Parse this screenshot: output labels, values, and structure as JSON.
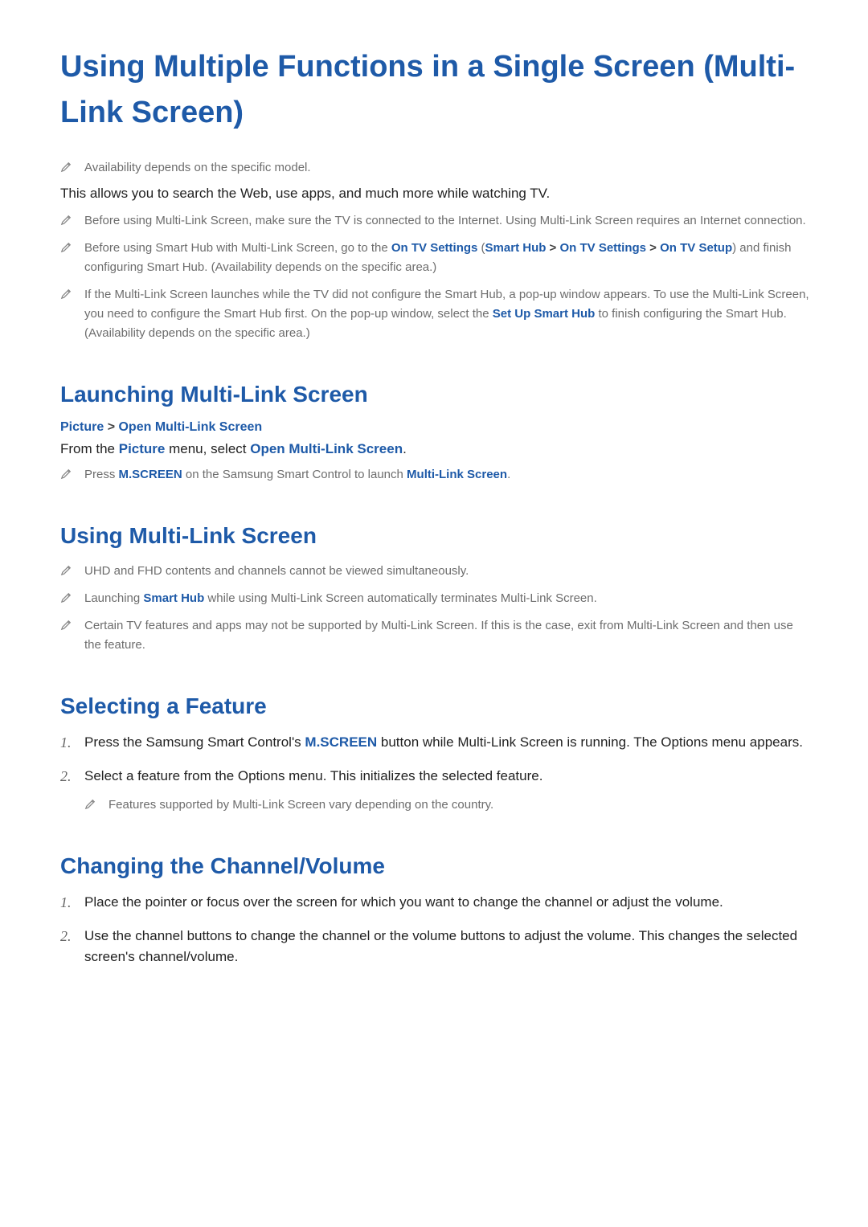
{
  "title": "Using Multiple Functions in a Single Screen (Multi-Link Screen)",
  "top_notes": [
    {
      "segments": [
        {
          "t": "Availability depends on the specific model."
        }
      ]
    }
  ],
  "intro": "This allows you to search the Web, use apps, and much more while watching TV.",
  "intro_notes": [
    {
      "segments": [
        {
          "t": "Before using Multi-Link Screen, make sure the TV is connected to the Internet. Using Multi-Link Screen requires an Internet connection."
        }
      ]
    },
    {
      "segments": [
        {
          "t": "Before using Smart Hub with Multi-Link Screen, go to the "
        },
        {
          "t": "On TV Settings",
          "kw": true
        },
        {
          "t": " ("
        },
        {
          "t": "Smart Hub",
          "kw": true
        },
        {
          "t": " > ",
          "sep": true
        },
        {
          "t": "On TV Settings",
          "kw": true
        },
        {
          "t": " > ",
          "sep": true
        },
        {
          "t": "On TV Setup",
          "kw": true
        },
        {
          "t": ") and finish configuring Smart Hub. (Availability depends on the specific area.)"
        }
      ]
    },
    {
      "segments": [
        {
          "t": "If the Multi-Link Screen launches while the TV did not configure the Smart Hub, a pop-up window appears. To use the Multi-Link Screen, you need to configure the Smart Hub first. On the pop-up window, select the "
        },
        {
          "t": "Set Up Smart Hub",
          "kw": true
        },
        {
          "t": " to finish configuring the Smart Hub. (Availability depends on the specific area.)"
        }
      ]
    }
  ],
  "sections": {
    "launching": {
      "heading": "Launching Multi-Link Screen",
      "breadcrumb": [
        {
          "t": "Picture",
          "kw": true
        },
        {
          "t": "Open Multi-Link Screen",
          "kw": true
        }
      ],
      "text_segments": [
        {
          "t": "From the "
        },
        {
          "t": "Picture",
          "kw": true
        },
        {
          "t": " menu, select "
        },
        {
          "t": "Open Multi-Link Screen",
          "kw": true
        },
        {
          "t": "."
        }
      ],
      "notes": [
        {
          "segments": [
            {
              "t": "Press "
            },
            {
              "t": "M.SCREEN",
              "kw": true
            },
            {
              "t": " on the Samsung Smart Control to launch "
            },
            {
              "t": "Multi-Link Screen",
              "kw": true
            },
            {
              "t": "."
            }
          ]
        }
      ]
    },
    "using": {
      "heading": "Using Multi-Link Screen",
      "notes": [
        {
          "segments": [
            {
              "t": "UHD and FHD contents and channels cannot be viewed simultaneously."
            }
          ]
        },
        {
          "segments": [
            {
              "t": "Launching "
            },
            {
              "t": "Smart Hub",
              "kw": true
            },
            {
              "t": " while using Multi-Link Screen automatically terminates Multi-Link Screen."
            }
          ]
        },
        {
          "segments": [
            {
              "t": "Certain TV features and apps may not be supported by Multi-Link Screen. If this is the case, exit from Multi-Link Screen and then use the feature."
            }
          ]
        }
      ]
    },
    "selecting": {
      "heading": "Selecting a Feature",
      "steps": [
        {
          "segments": [
            {
              "t": "Press the Samsung Smart Control's "
            },
            {
              "t": "M.SCREEN",
              "kw": true
            },
            {
              "t": " button while Multi-Link Screen is running. The Options menu appears."
            }
          ]
        },
        {
          "segments": [
            {
              "t": "Select a feature from the Options menu. This initializes the selected feature."
            }
          ],
          "subnotes": [
            {
              "segments": [
                {
                  "t": "Features supported by Multi-Link Screen vary depending on the country."
                }
              ]
            }
          ]
        }
      ]
    },
    "changing": {
      "heading": "Changing the Channel/Volume",
      "steps": [
        {
          "segments": [
            {
              "t": "Place the pointer or focus over the screen for which you want to change the channel or adjust the volume."
            }
          ]
        },
        {
          "segments": [
            {
              "t": "Use the channel buttons to change the channel or the volume buttons to adjust the volume. This changes the selected screen's channel/volume."
            }
          ]
        }
      ]
    }
  }
}
